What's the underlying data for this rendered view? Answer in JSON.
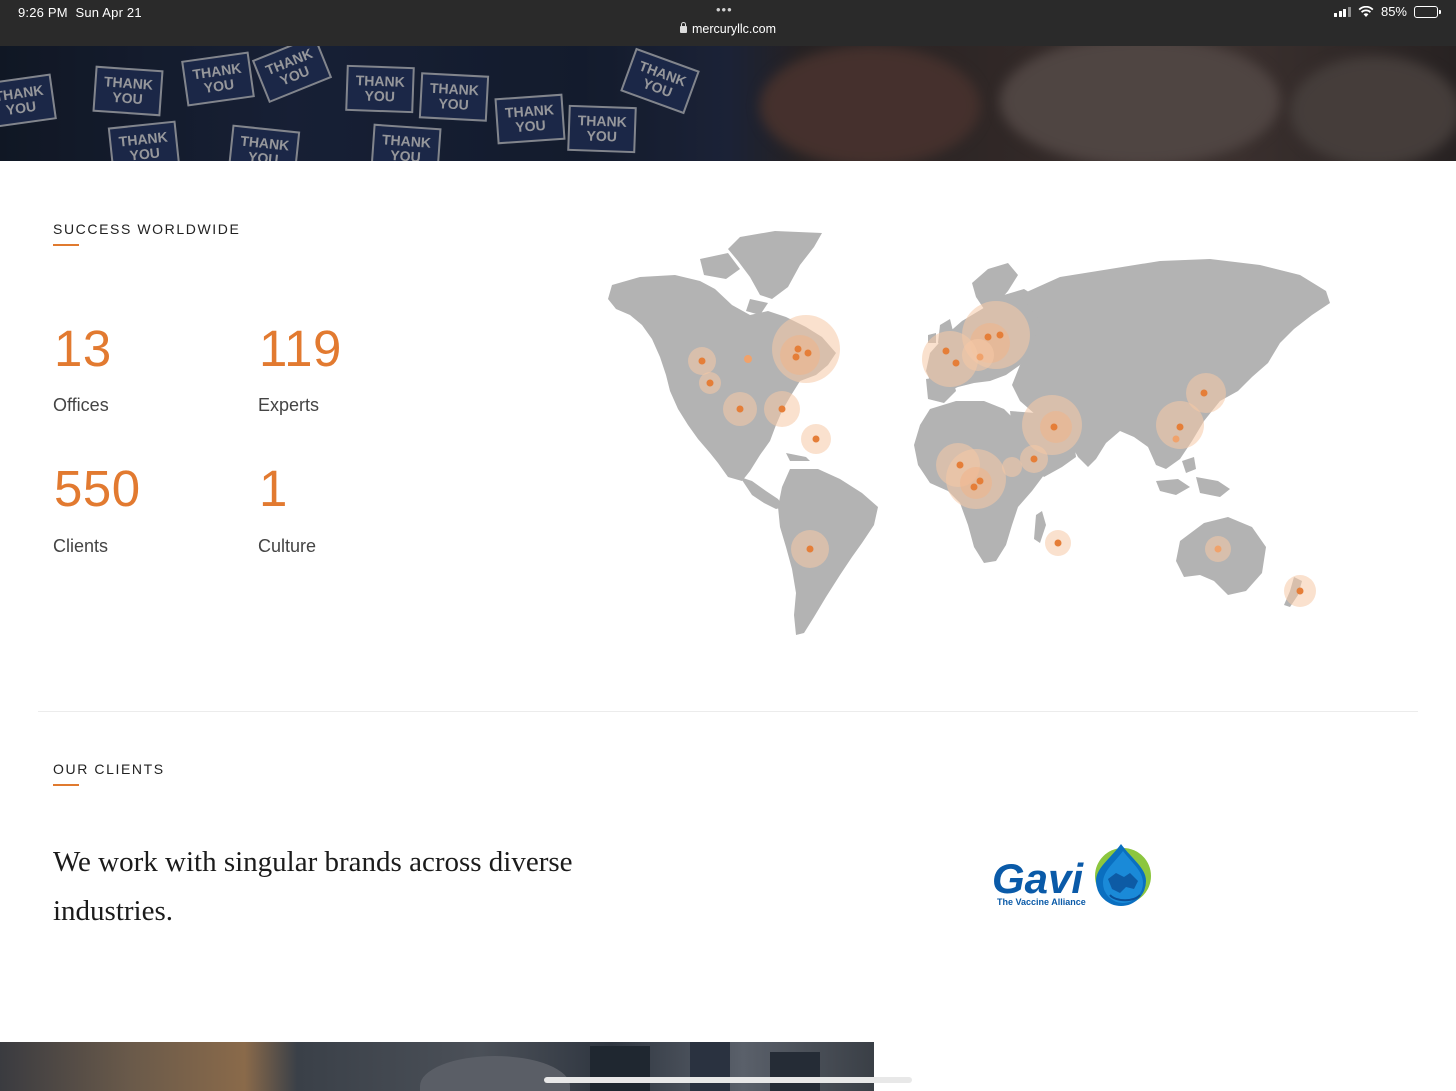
{
  "status_bar": {
    "time": "9:26 PM",
    "date": "Sun Apr 21",
    "dots": "•••",
    "url": "mercuryllc.com",
    "battery": "85%",
    "battery_level": 0.85
  },
  "hero": {
    "sign_text": "THANK YOU"
  },
  "success": {
    "label": "SUCCESS WORLDWIDE",
    "stats": [
      {
        "value": "13",
        "label": "Offices"
      },
      {
        "value": "119",
        "label": "Experts"
      },
      {
        "value": "550",
        "label": "Clients"
      },
      {
        "value": "1",
        "label": "Culture"
      }
    ]
  },
  "clients": {
    "label": "OUR CLIENTS",
    "heading": "We work with singular brands across diverse industries.",
    "logo": {
      "name": "Gavi",
      "tagline": "The Vaccine Alliance"
    }
  },
  "colors": {
    "accent": "#e27a30",
    "map_land": "#b3b3b3",
    "gavi_blue": "#0a5aa8",
    "gavi_green": "#8cc63f"
  }
}
